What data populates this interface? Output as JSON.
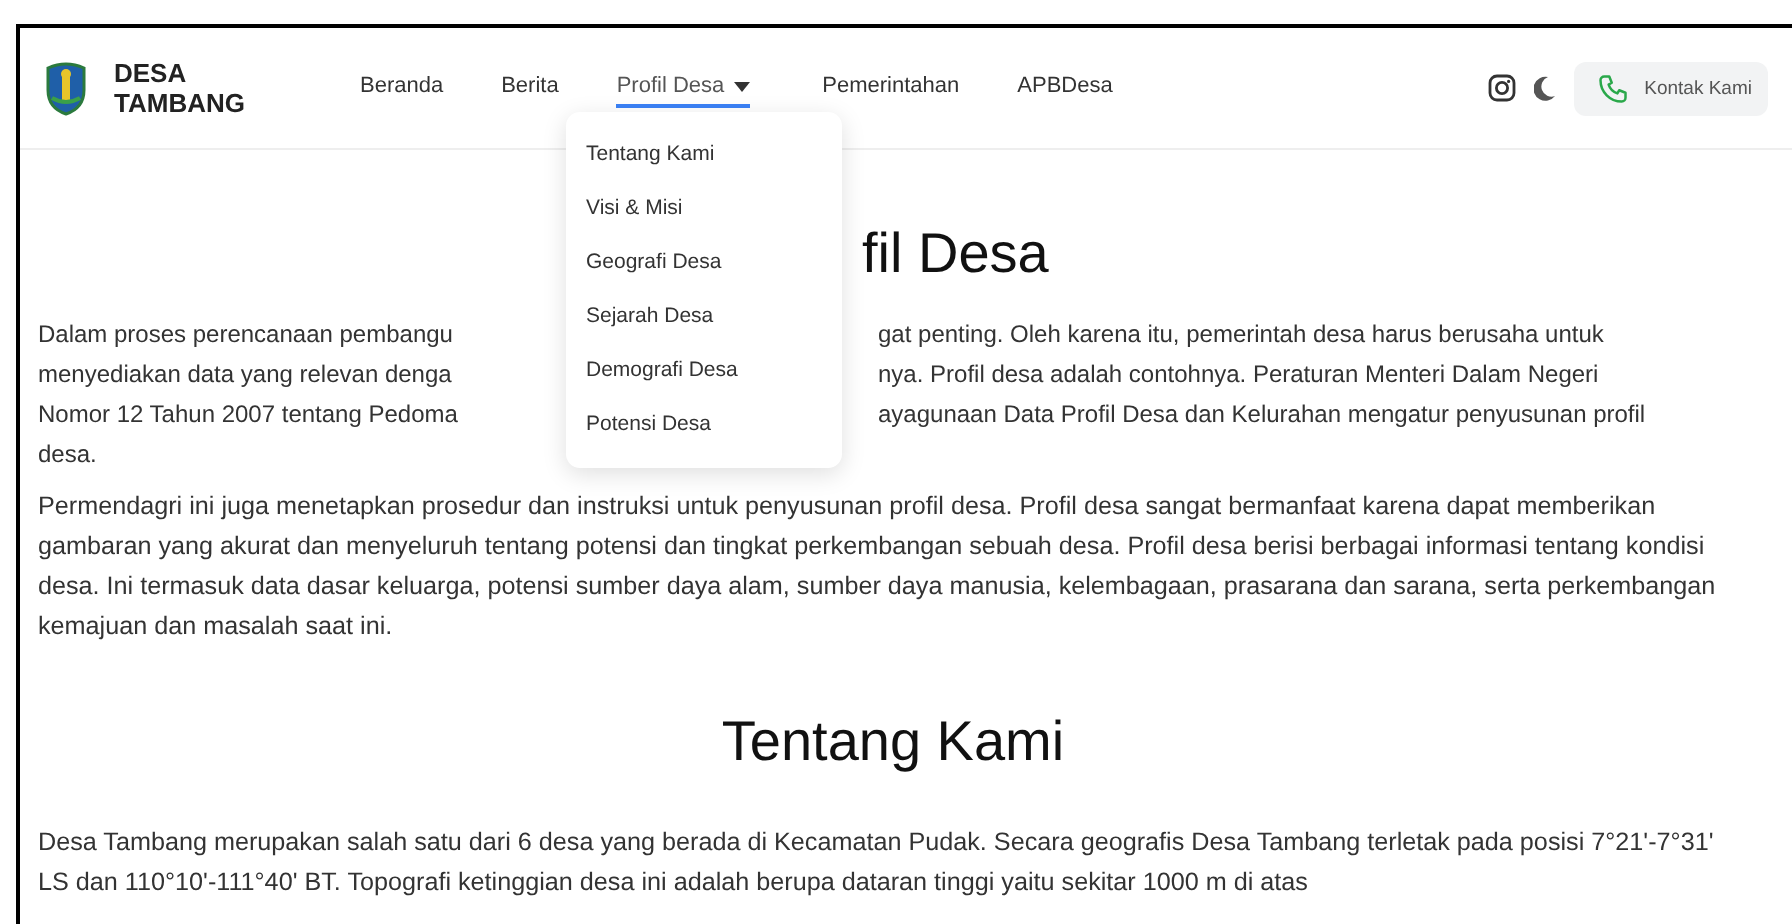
{
  "header": {
    "brand": [
      "DESA",
      "TAMBANG"
    ],
    "nav": [
      {
        "label": "Beranda",
        "selected": false,
        "dropdown": false
      },
      {
        "label": "Berita",
        "selected": false,
        "dropdown": false
      },
      {
        "label": "Profil Desa",
        "selected": true,
        "dropdown": true
      },
      {
        "label": "Pemerintahan",
        "selected": false,
        "dropdown": false
      },
      {
        "label": "APBDesa",
        "selected": false,
        "dropdown": false
      }
    ],
    "contact_button": "Kontak Kami"
  },
  "dropdown_menu": {
    "items": [
      "Tentang Kami",
      "Visi & Misi",
      "Geografi Desa",
      "Sejarah Desa",
      "Demografi Desa",
      "Potensi Desa"
    ]
  },
  "section_1": {
    "heading_visible": "fil Desa",
    "paragraph_1_lines": [
      {
        "left": "Dalam proses perencanaan pembangu",
        "right": "gat penting. Oleh karena itu, pemerintah desa harus berusaha untuk"
      },
      {
        "left": "menyediakan data yang relevan denga",
        "right": "nya. Profil desa adalah contohnya. Peraturan Menteri Dalam Negeri"
      },
      {
        "left": "Nomor 12 Tahun 2007 tentang Pedoma",
        "right": "ayagunaan Data Profil Desa dan Kelurahan mengatur penyusunan profil"
      },
      {
        "left": "desa."
      }
    ],
    "paragraph_2": "Permendagri ini juga menetapkan prosedur dan instruksi untuk penyusunan profil desa. Profil desa sangat bermanfaat karena dapat memberikan gambaran yang akurat dan menyeluruh tentang potensi dan tingkat perkembangan sebuah desa. Profil desa berisi berbagai informasi tentang kondisi desa. Ini termasuk data dasar keluarga, potensi sumber daya alam, sumber daya manusia, kelembagaan, prasarana dan sarana, serta perkembangan kemajuan dan masalah saat ini."
  },
  "section_2": {
    "heading": "Tentang Kami",
    "paragraph": "Desa Tambang merupakan salah satu dari 6 desa yang berada di Kecamatan Pudak. Secara geografis Desa Tambang terletak pada posisi 7°21'-7°31' LS dan 110°10'-111°40' BT. Topografi ketinggian desa ini adalah berupa dataran tinggi yaitu sekitar 1000 m di atas"
  }
}
